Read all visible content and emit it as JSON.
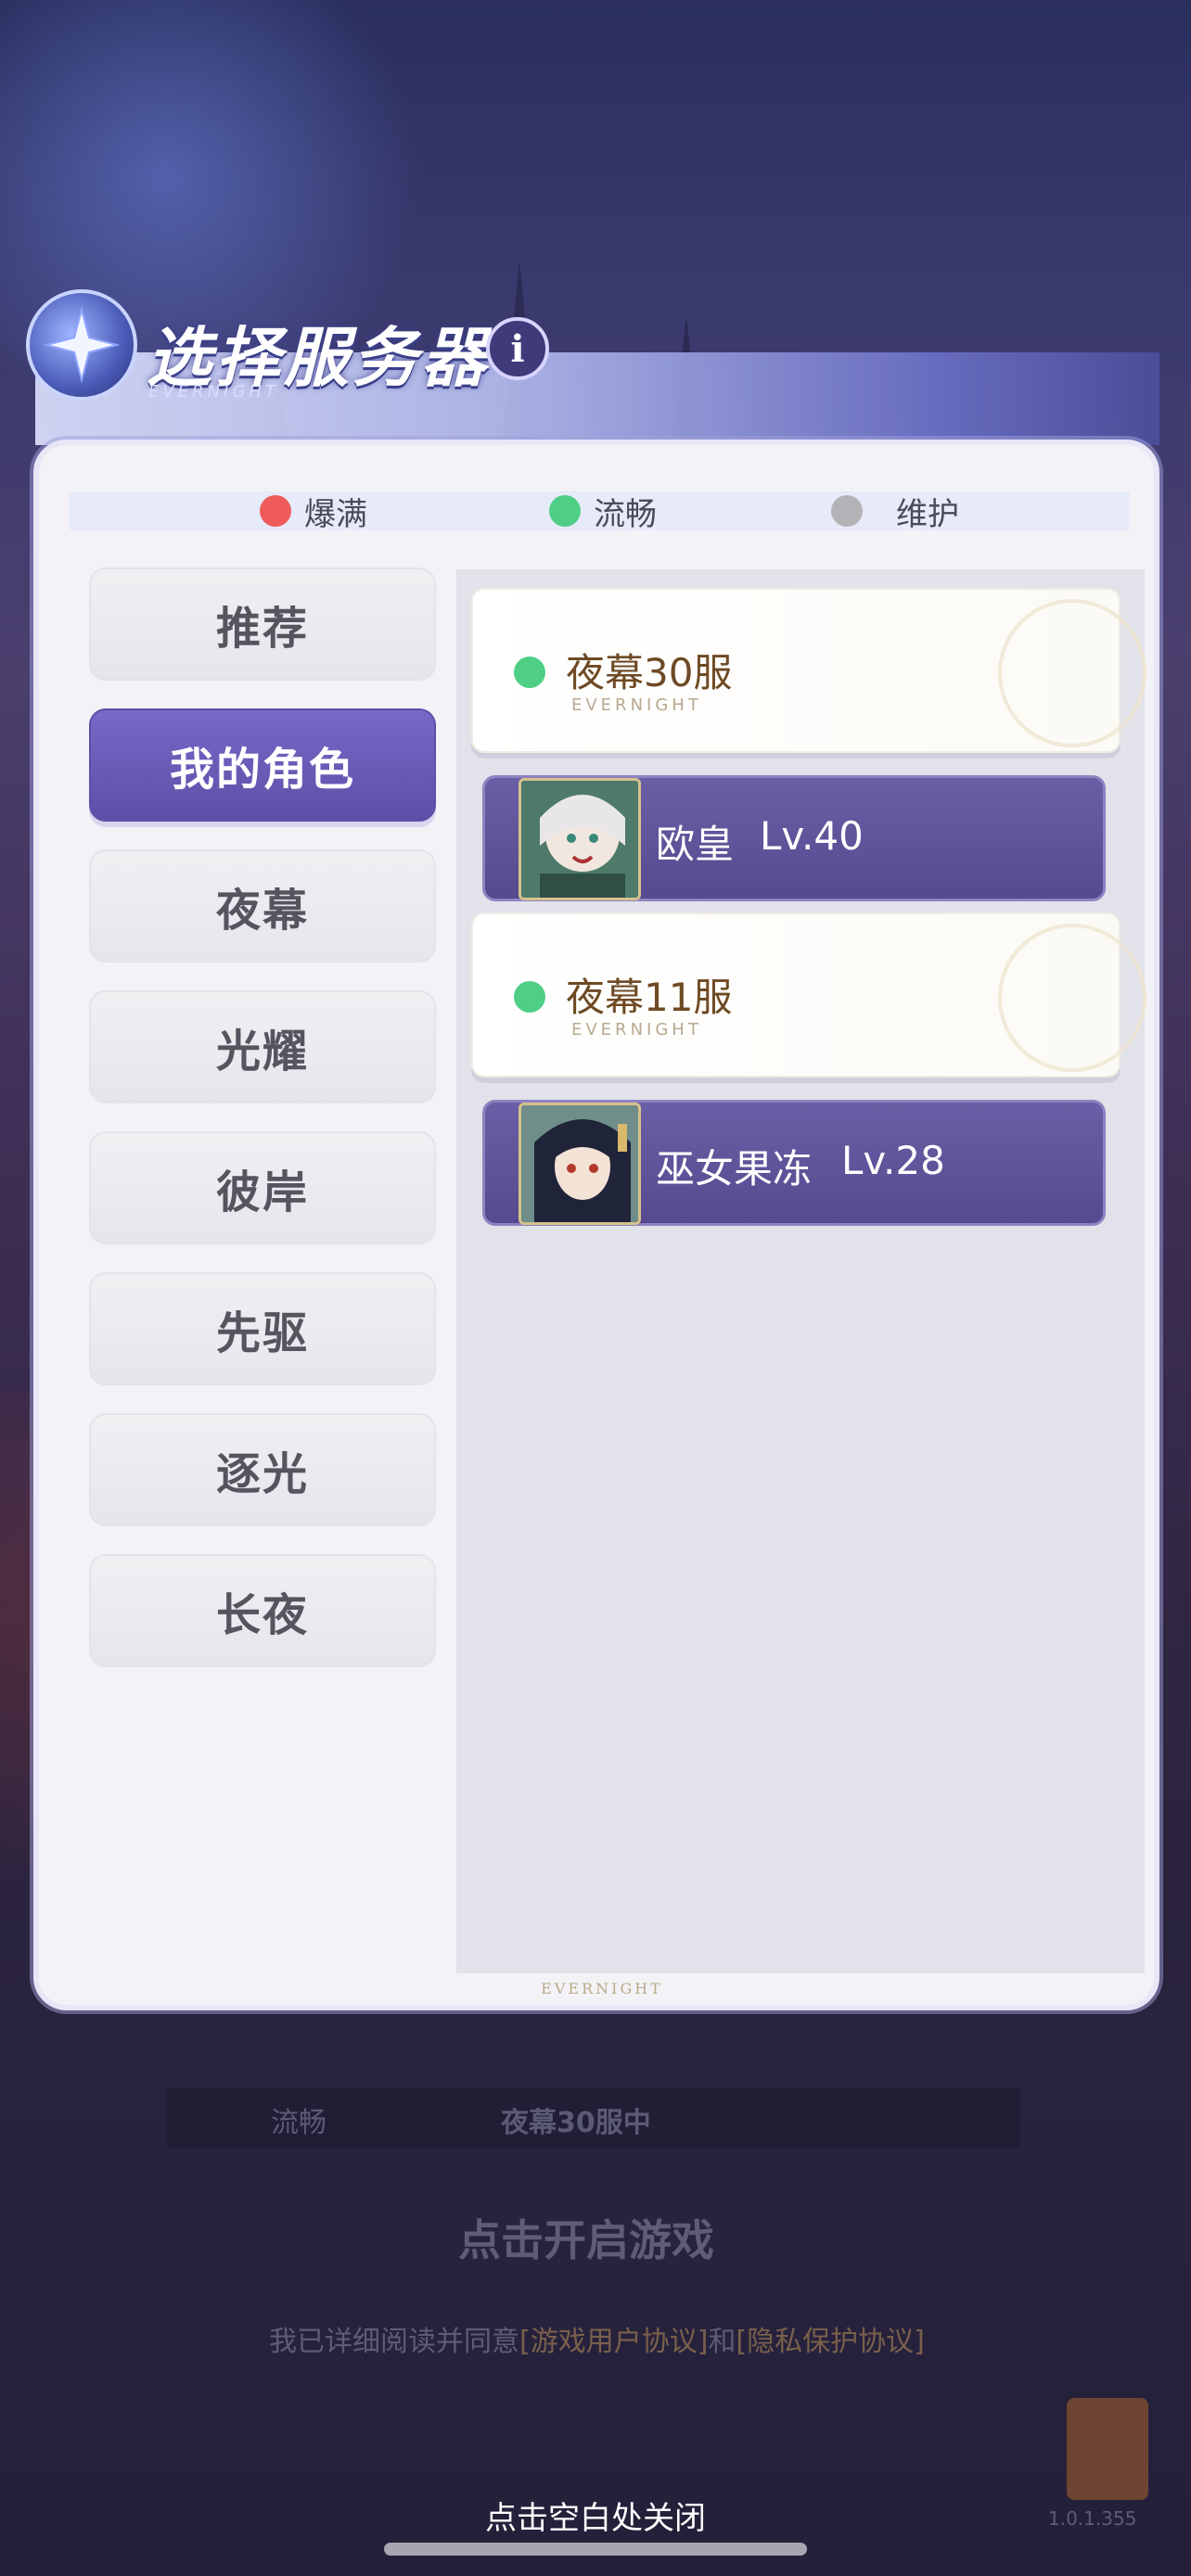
{
  "header": {
    "title": "选择服务器",
    "subtitle": "EVERNIGHT",
    "info_label": "i"
  },
  "legend": [
    {
      "label": "爆满",
      "color": "#ef5b5b"
    },
    {
      "label": "流畅",
      "color": "#4fce86"
    },
    {
      "label": "维护",
      "color": "#b4b4b8"
    }
  ],
  "tabs": [
    {
      "label": "推荐",
      "active": false
    },
    {
      "label": "我的角色",
      "active": true
    },
    {
      "label": "夜幕",
      "active": false
    },
    {
      "label": "光耀",
      "active": false
    },
    {
      "label": "彼岸",
      "active": false
    },
    {
      "label": "先驱",
      "active": false
    },
    {
      "label": "逐光",
      "active": false
    },
    {
      "label": "长夜",
      "active": false
    }
  ],
  "servers": [
    {
      "name": "夜幕30服",
      "sub": "EVERNIGHT",
      "status_color": "#4fce86",
      "character": {
        "name": "欧皇",
        "level": "Lv.40",
        "avatar": "white-haired-elf-avatar"
      }
    },
    {
      "name": "夜幕11服",
      "sub": "EVERNIGHT",
      "status_color": "#4fce86",
      "character": {
        "name": "巫女果冻",
        "level": "Lv.28",
        "avatar": "dark-haired-girl-avatar"
      }
    }
  ],
  "panel_footer": "EVERNIGHT",
  "background": {
    "status_label": "流畅",
    "current_server": "夜幕30服中",
    "start_game": "点击开启游戏",
    "agreement_prefix": "我已详细阅读并同意",
    "user_agreement": "[游戏用户协议]",
    "and": "和",
    "privacy_agreement": "[隐私保护协议]",
    "version": "1.0.1.355"
  },
  "close_hint": "点击空白处关闭"
}
